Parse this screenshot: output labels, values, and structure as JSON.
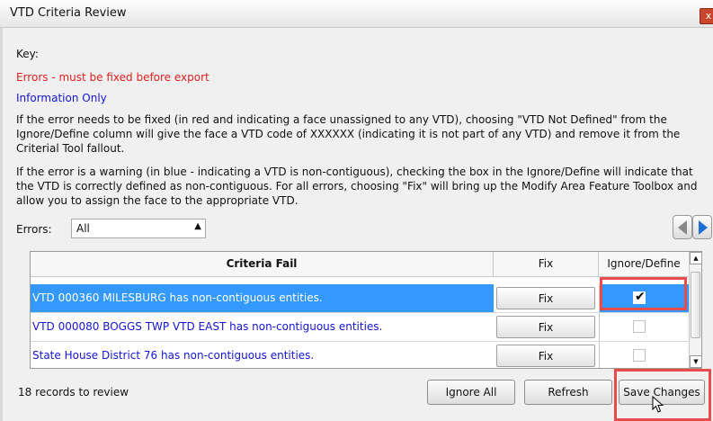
{
  "window": {
    "title": "VTD Criteria Review",
    "close_label": "x"
  },
  "key": {
    "label": "Key:",
    "errors_text": "Errors - must be fixed before export",
    "info_text": "Information Only",
    "error_color": "#e02020",
    "info_color": "#1515d6"
  },
  "instructions": {
    "p1": "If the error needs to be fixed (in red and indicating a face unassigned to any VTD), choosing \"VTD Not Defined\" from the Ignore/Define column will give the face a VTD code of XXXXXX (indicating it is not part of any VTD) and remove it from the Criterial Tool fallout.",
    "p2": "If the error is a warning (in blue - indicating a VTD is non-contiguous), checking the box in the Ignore/Define will indicate that the VTD is correctly defined as non-contiguous. For all errors, choosing \"Fix\" will bring up the Modify Area Feature Toolbox and allow you to assign the face to the appropriate VTD."
  },
  "filter": {
    "label": "Errors:",
    "selected": "All"
  },
  "nav": {
    "prev_icon": "triangle-left-icon",
    "next_icon": "triangle-right-icon"
  },
  "table": {
    "headers": {
      "criteria": "Criteria Fail",
      "fix": "Fix",
      "ignore": "Ignore/Define"
    },
    "rows": [
      {
        "text": "VTD 000360 MILESBURG has non-contiguous entities.",
        "fix_label": "Fix",
        "checked": "✔",
        "selected": true
      },
      {
        "text": "VTD 000080 BOGGS TWP VTD EAST has non-contiguous entities.",
        "fix_label": "Fix",
        "checked": "",
        "selected": false
      },
      {
        "text": "State House District 76 has non-contiguous entities.",
        "fix_label": "Fix",
        "checked": "",
        "selected": false
      }
    ],
    "selected_color": "#3399ff"
  },
  "footer": {
    "records": "18  records to review",
    "ignore_all": "Ignore All",
    "refresh": "Refresh",
    "save_changes": "Save Changes"
  },
  "highlight_color": "#e84b4b"
}
